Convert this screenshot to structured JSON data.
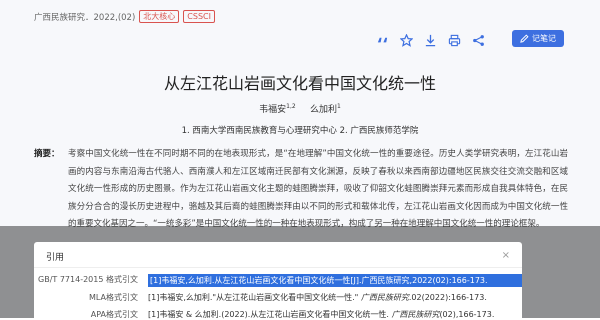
{
  "journal": {
    "source": "广西民族研究．2022,(02)",
    "badges": [
      "北大核心",
      "CSSCI"
    ]
  },
  "toolbar": {
    "icons": [
      "quote-icon",
      "star-icon",
      "download-icon",
      "print-icon",
      "share-icon"
    ],
    "note_label": "记笔记"
  },
  "article": {
    "title": "从左江花山岩画文化看中国文化统一性",
    "authors": [
      {
        "name": "韦福安",
        "sup": "1,2"
      },
      {
        "name": "么加利",
        "sup": "1"
      }
    ],
    "affiliations": "1. 西南大学西南民族教育与心理研究中心   2. 广西民族师范学院",
    "abstract_label": "摘要：",
    "abstract": "考察中国文化统一性在不同时期不同的在地表现形式，是“在地理解”中国文化统一性的重要途径。历史人类学研究表明，左江花山岩画的内容与东南沿海古代骆人、西南濮人和左江区域南迁民部有文化渊源，反映了春秋以来西南部边疆地区民族交往交流交融和区域文化统一性形成的历史图景。作为左江花山岩画文化主题的蛙图腾崇拜，吸收了仰韶文化蛙图腾崇拜元素而形成自我具体特色，在民族分分合合的漫长历史进程中，骆越及其后裔的蛙图腾崇拜由以不同的形式和载体北传，左江花山岩画文化因而成为中国文化统一性的重要文化基因之一。“一统多彩”是中国文化统一性的一种在地表现形式，构成了另一种在地理解中国文化统一性的理论框架。"
  },
  "cite_modal": {
    "title": "引用",
    "close": "×",
    "rows": [
      {
        "format": "GB/T 7714-2015 格式引文",
        "text": "[1]韦福安,么加利.从左江花山岩画文化看中国文化统一性[J].广西民族研究,2022(02):166-173."
      },
      {
        "format": "MLA格式引文",
        "text_prefix": "[1]韦福安,么加利.\"从左江花山岩画文化看中国文化统一性.\" ",
        "text_italic": "广西民族研究",
        "text_suffix": ".02(2022):166-173."
      },
      {
        "format": "APA格式引文",
        "text_prefix": "[1]韦福安 & 么加利.(2022).从左江花山岩画文化看中国文化统一性. ",
        "text_italic": "广西民族研究",
        "text_suffix": "(02),166-173."
      }
    ]
  },
  "colors": {
    "accent": "#3d6fe0",
    "badge": "#d9534f",
    "selection": "#2f6fde"
  }
}
